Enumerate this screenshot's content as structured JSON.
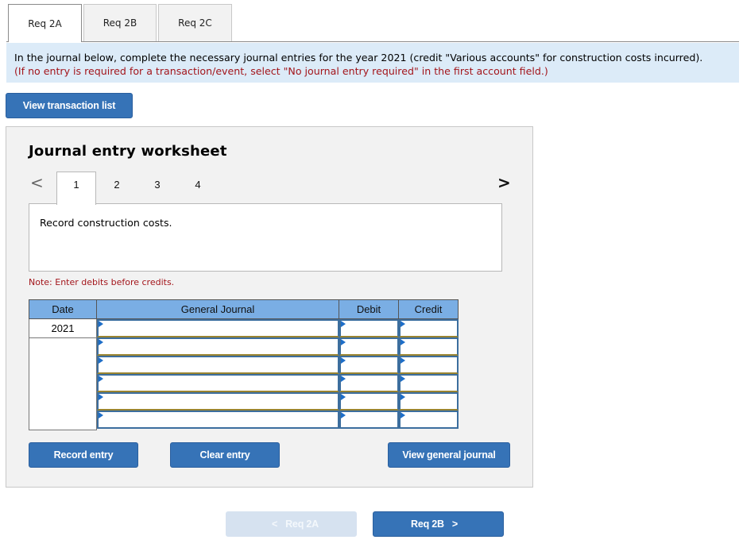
{
  "req_tabs": [
    {
      "label": "Req 2A",
      "active": true
    },
    {
      "label": "Req 2B",
      "active": false
    },
    {
      "label": "Req 2C",
      "active": false
    }
  ],
  "instructions": {
    "line1": "In the journal below, complete the necessary journal entries for the year 2021 (credit \"Various accounts\" for construction costs incurred).",
    "line2": "(If no entry is required for a transaction/event, select \"No journal entry required\" in the first account field.)"
  },
  "buttons": {
    "view_transaction_list": "View transaction list",
    "record_entry": "Record entry",
    "clear_entry": "Clear entry",
    "view_general_journal": "View general journal"
  },
  "worksheet": {
    "title": "Journal entry worksheet",
    "prev_icon": "chevron-left-icon",
    "next_icon": "chevron-right-icon",
    "prev_glyph": "<",
    "next_glyph": ">",
    "steps": [
      "1",
      "2",
      "3",
      "4"
    ],
    "active_step": "1",
    "description": "Record construction costs.",
    "note": "Note: Enter debits before credits."
  },
  "journal_table": {
    "headers": {
      "date": "Date",
      "general_journal": "General Journal",
      "debit": "Debit",
      "credit": "Credit"
    },
    "rows": [
      {
        "date": "2021",
        "account": "",
        "debit": "",
        "credit": ""
      },
      {
        "date": "",
        "account": "",
        "debit": "",
        "credit": ""
      },
      {
        "date": "",
        "account": "",
        "debit": "",
        "credit": ""
      },
      {
        "date": "",
        "account": "",
        "debit": "",
        "credit": ""
      },
      {
        "date": "",
        "account": "",
        "debit": "",
        "credit": ""
      },
      {
        "date": "",
        "account": "",
        "debit": "",
        "credit": ""
      }
    ]
  },
  "bottom_nav": {
    "prev_label": "Req 2A",
    "prev_glyph": "<",
    "next_label": "Req 2B",
    "next_glyph": ">"
  },
  "colors": {
    "primary_button": "#3673b7",
    "disabled_button": "#d6e2f0",
    "instruction_bg": "#dcebf8",
    "note_red": "#a3151b",
    "table_header": "#7aaee4"
  }
}
